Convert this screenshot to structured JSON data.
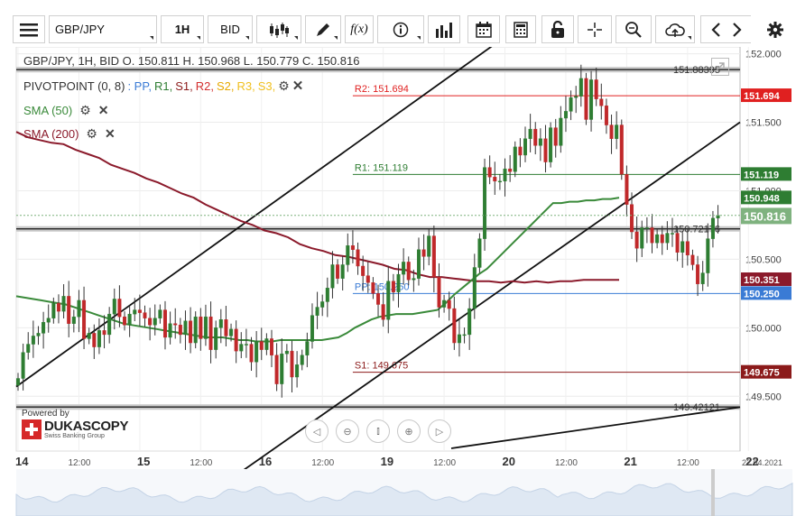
{
  "toolbar": {
    "menu_icon": "hamburger-icon",
    "symbol": "GBP/JPY",
    "timeframe": "1H",
    "price_type": "BID",
    "tools": [
      "candles-icon",
      "pencil-icon",
      "function-icon",
      "info-icon",
      "bars-icon",
      "calendar-icon",
      "calculator-icon",
      "lock-icon",
      "crosshair-icon",
      "zoom-icon",
      "cloud-upload-icon",
      "chevron-left-icon",
      "chevron-right-icon",
      "gear-icon"
    ],
    "function_label": "f(x)"
  },
  "legend": {
    "ohlc": "GBP/JPY, 1H, BID    O. 150.811 H. 150.968 L. 150.779 C. 150.816",
    "pivot_title": "PIVOTPOINT (0, 8)",
    "pivot_items": [
      {
        "label": ": PP,",
        "color": "#3a7bd5"
      },
      {
        "label": "R1,",
        "color": "#2e7d32"
      },
      {
        "label": "S1,",
        "color": "#8b1a1a"
      },
      {
        "label": "R2,",
        "color": "#d32f2f"
      },
      {
        "label": "S2,",
        "color": "#e6a800"
      },
      {
        "label": "R3,",
        "color": "#f0c020"
      },
      {
        "label": "S3,",
        "color": "#f0c020"
      }
    ],
    "sma50": "SMA (50)",
    "sma200": "SMA (200)"
  },
  "branding": {
    "powered_by": "Powered by",
    "name": "DUKASCOPY",
    "subtitle": "Swiss Banking Group"
  },
  "colors": {
    "sma50": "#3a8a3a",
    "sma200": "#8b1a2b",
    "r2": "#e02020",
    "r1": "#2e7d32",
    "pp": "#3a7bd5",
    "s1": "#8b1a1a",
    "current": "#7fb27f",
    "bull": "#2e7d32",
    "bear": "#c62828"
  },
  "chart_data": {
    "type": "candlestick",
    "title": "GBP/JPY, 1H, BID",
    "ohlc_last": {
      "open": 150.811,
      "high": 150.968,
      "low": 150.779,
      "close": 150.816
    },
    "ylim": [
      149.1,
      152.05
    ],
    "y_ticks": [
      152.0,
      151.5,
      151.0,
      150.5,
      150.0,
      149.5
    ],
    "y_tick_labels": [
      "152.000",
      "151.500",
      "151.000",
      "150.500",
      "150.000",
      "149.500"
    ],
    "x_labels": [
      {
        "label": "14",
        "major": true,
        "i": 0
      },
      {
        "label": "12:00",
        "major": false,
        "i": 12
      },
      {
        "label": "15",
        "major": true,
        "i": 24
      },
      {
        "label": "12:00",
        "major": false,
        "i": 36
      },
      {
        "label": "16",
        "major": true,
        "i": 48
      },
      {
        "label": "12:00",
        "major": false,
        "i": 60
      },
      {
        "label": "19",
        "major": true,
        "i": 72
      },
      {
        "label": "12:00",
        "major": false,
        "i": 84
      },
      {
        "label": "20",
        "major": true,
        "i": 96
      },
      {
        "label": "12:00",
        "major": false,
        "i": 108
      },
      {
        "label": "21",
        "major": true,
        "i": 120
      },
      {
        "label": "12:00",
        "major": false,
        "i": 132
      },
      {
        "label": "22",
        "major": true,
        "i": 144
      }
    ],
    "date_right": "22.04.2021",
    "close_series": [
      149.63,
      149.82,
      149.88,
      149.94,
      149.96,
      150.04,
      150.07,
      150.18,
      150.12,
      150.23,
      150.03,
      150.08,
      150.2,
      149.92,
      149.96,
      149.86,
      149.98,
      149.95,
      150.1,
      150.21,
      150.08,
      150.02,
      150.1,
      150.13,
      150.11,
      150.07,
      150.02,
      150.07,
      150.13,
      149.93,
      150.03,
      150.02,
      149.95,
      150.05,
      149.89,
      150.08,
      149.92,
      150.08,
      149.84,
      150.0,
      150.06,
      149.94,
      149.99,
      149.83,
      149.88,
      149.88,
      149.75,
      149.9,
      149.84,
      149.92,
      149.8,
      149.59,
      149.81,
      149.83,
      149.64,
      149.73,
      149.8,
      149.9,
      150.09,
      150.15,
      150.19,
      150.29,
      150.46,
      150.36,
      150.46,
      150.6,
      150.57,
      150.45,
      150.38,
      150.33,
      150.25,
      150.17,
      150.06,
      150.34,
      150.26,
      150.39,
      150.48,
      150.35,
      150.36,
      150.57,
      150.52,
      150.67,
      150.37,
      150.15,
      150.2,
      150.14,
      149.89,
      149.95,
      149.95,
      150.14,
      150.44,
      150.65,
      151.17,
      151.1,
      151.07,
      151.07,
      151.16,
      151.14,
      151.32,
      151.26,
      151.38,
      151.45,
      151.33,
      151.38,
      151.21,
      151.46,
      151.33,
      151.53,
      151.58,
      151.68,
      151.69,
      151.82,
      151.52,
      151.81,
      151.67,
      151.62,
      151.48,
      151.38,
      151.48,
      151.12,
      150.9,
      150.7,
      150.58,
      150.73,
      150.73,
      150.62,
      150.68,
      150.62,
      150.69,
      150.69,
      150.55,
      150.63,
      150.53,
      150.46,
      150.32,
      150.4,
      150.65,
      150.8,
      150.82
    ],
    "sma50_series": [
      150.23,
      150.22,
      150.21,
      150.2,
      150.19,
      150.18,
      150.17,
      150.15,
      150.13,
      150.11,
      150.09,
      150.07,
      150.05,
      150.03,
      150.02,
      150.01,
      150.0,
      149.99,
      149.98,
      149.97,
      149.96,
      149.95,
      149.94,
      149.93,
      149.93,
      149.93,
      149.92,
      149.91,
      149.91,
      149.9,
      149.9,
      149.9,
      149.91,
      149.91,
      149.91,
      149.91,
      149.91,
      149.91,
      149.92,
      149.93,
      149.96,
      150.0,
      150.03,
      150.06,
      150.08,
      150.09,
      150.1,
      150.1,
      150.1,
      150.11,
      150.12,
      150.13,
      150.18,
      150.24,
      150.29,
      150.34,
      150.39,
      150.43,
      150.49,
      150.55,
      150.61,
      150.67,
      150.73,
      150.79,
      150.85,
      150.91,
      150.91,
      150.92,
      150.92,
      150.93,
      150.93,
      150.94,
      150.94,
      150.95
    ],
    "sma200_series": [
      151.43,
      151.39,
      151.37,
      151.35,
      151.34,
      151.3,
      151.27,
      151.24,
      151.19,
      151.16,
      151.13,
      151.09,
      151.06,
      151.02,
      150.98,
      150.95,
      150.9,
      150.86,
      150.82,
      150.78,
      150.75,
      150.71,
      150.69,
      150.66,
      150.61,
      150.58,
      150.56,
      150.53,
      150.52,
      150.5,
      150.48,
      150.46,
      150.43,
      150.42,
      150.39,
      150.37,
      150.37,
      150.36,
      150.35,
      150.34,
      150.34,
      150.33,
      150.34,
      150.33,
      150.34,
      150.33,
      150.34,
      150.34,
      150.35,
      150.35,
      150.35,
      150.35
    ],
    "levels": [
      {
        "name": "R2",
        "label": "R2: 151.694",
        "value": 151.694,
        "tag": "151.694",
        "color": "#e02020"
      },
      {
        "name": "R1",
        "label": "R1: 151.119",
        "value": 151.119,
        "tag": "151.119",
        "color": "#2e7d32"
      },
      {
        "name": "PP",
        "label": "PP: 150.250",
        "value": 150.25,
        "tag": "150.250",
        "color": "#3a7bd5"
      },
      {
        "name": "S1",
        "label": "S1: 149.675",
        "value": 149.675,
        "tag": "149.675",
        "color": "#8b1a1a"
      }
    ],
    "hlines": [
      {
        "label": "151.88395",
        "value": 151.88395
      },
      {
        "label": "150.72176",
        "value": 150.72176
      },
      {
        "label": "149.42121",
        "value": 149.42121
      }
    ],
    "price_tags": [
      {
        "label": "150.948",
        "value": 150.948,
        "color": "#2e7d32"
      },
      {
        "label": "150.816",
        "value": 150.816,
        "color": "#7fb27f"
      },
      {
        "label": "150.351",
        "value": 150.351,
        "color": "#8b1a2b"
      }
    ]
  }
}
